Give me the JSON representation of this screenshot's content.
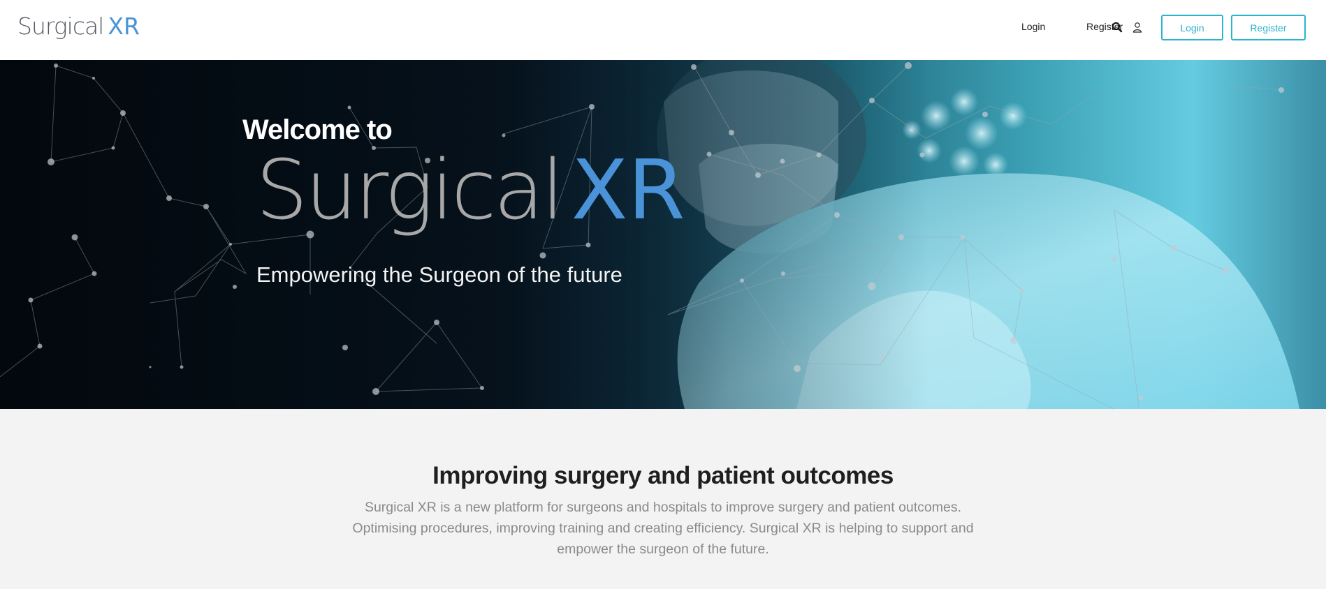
{
  "header": {
    "logo_word": "Surgical",
    "logo_accent": "XR",
    "nav_login": "Login",
    "nav_register": "Register",
    "btn_login": "Login",
    "btn_register": "Register",
    "icons": [
      "search-icon",
      "user-icon"
    ]
  },
  "hero": {
    "welcome": "Welcome to",
    "brand_word": "Surgical",
    "brand_accent": "XR",
    "tagline": "Empowering the Surgeon of the future"
  },
  "intro": {
    "title": "Improving surgery and patient outcomes",
    "body": "Surgical XR is a new platform for surgeons and hospitals to improve surgery and patient outcomes. Optimising procedures, improving training and creating efficiency. Surgical XR is helping to support and empower the surgeon of the future."
  },
  "colors": {
    "accent": "#4b93d8",
    "button": "#2cb3cf",
    "section_bg": "#f3f3f3"
  }
}
